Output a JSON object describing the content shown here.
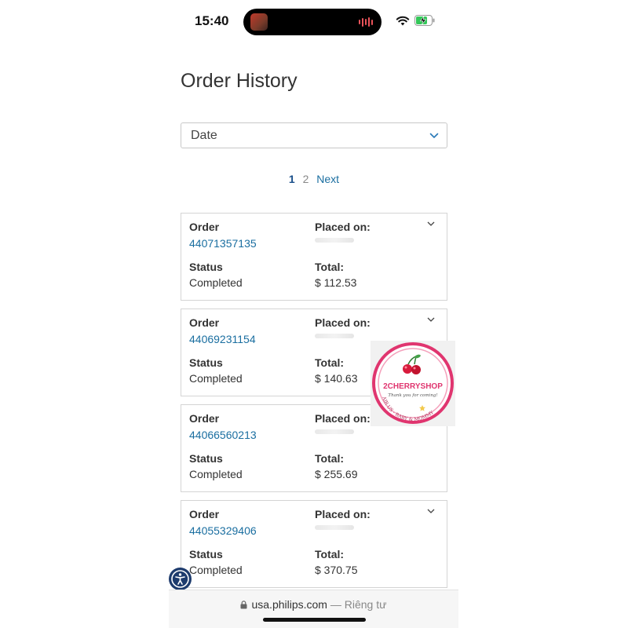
{
  "status_bar": {
    "time": "15:40",
    "wifi_icon": "wifi-icon",
    "battery_icon": "battery-charging-icon"
  },
  "page": {
    "title": "Order History"
  },
  "sort": {
    "selected": "Date",
    "icon": "chevron-down-icon"
  },
  "pagination": {
    "pages": [
      "1",
      "2"
    ],
    "next": "Next",
    "current": "1"
  },
  "labels": {
    "order": "Order",
    "placed_on": "Placed on:",
    "status": "Status",
    "total": "Total:"
  },
  "orders": [
    {
      "number": "44071357135",
      "status": "Completed",
      "total": "$ 112.53"
    },
    {
      "number": "44069231154",
      "status": "Completed",
      "total": "$ 140.63"
    },
    {
      "number": "44066560213",
      "status": "Completed",
      "total": "$ 255.69"
    },
    {
      "number": "44055329406",
      "status": "Completed",
      "total": "$ 370.75"
    }
  ],
  "sticker": {
    "brand": "2CHERRYSHOP",
    "tagline": "Thank you for coming!",
    "arc_text": "AIR US - BABY & MOMMY"
  },
  "browser": {
    "domain": "usa.philips.com",
    "mode": "— Riêng tư"
  },
  "colors": {
    "link": "#1a6ea0",
    "accessibility": "#1d3b6d",
    "sticker_pink": "#e0356f"
  }
}
